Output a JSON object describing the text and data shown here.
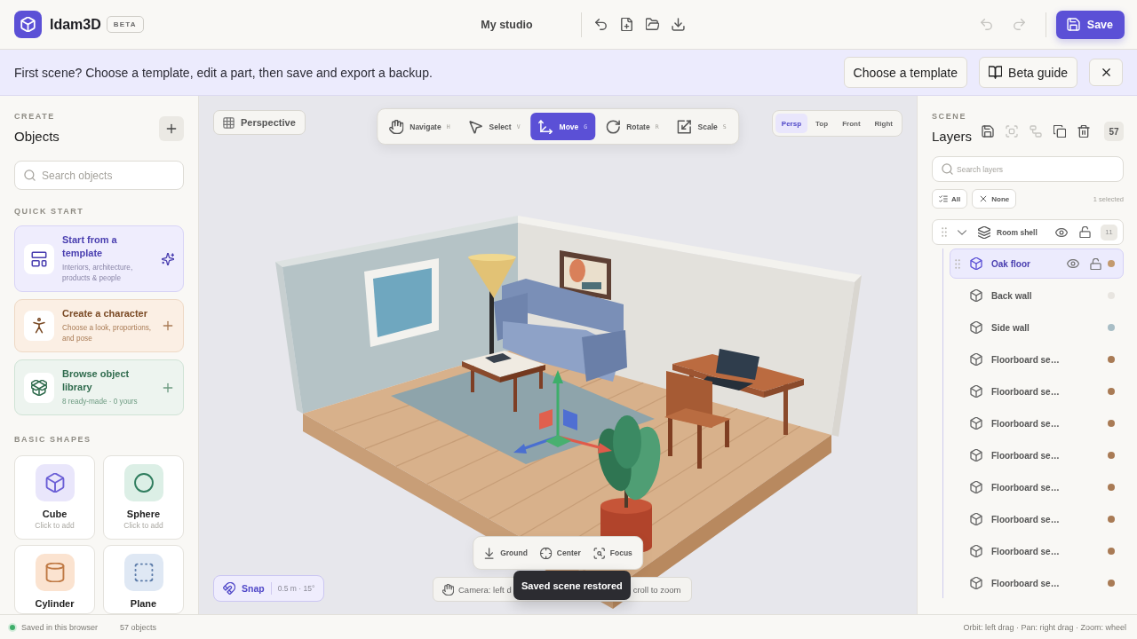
{
  "header": {
    "app_name": "Idam3D",
    "badge": "BETA",
    "project_title": "My studio",
    "history": [
      {
        "kind": "undo",
        "disabled": true
      },
      {
        "kind": "redo",
        "disabled": true
      }
    ],
    "save_label": "Save"
  },
  "banner": {
    "message": "First scene? Choose a template, edit a part, then save and export a backup.",
    "actions": [
      {
        "kind": "text",
        "label": "Choose a template"
      },
      {
        "kind": "guide",
        "label": "Beta guide"
      }
    ]
  },
  "objects_panel": {
    "eyebrow": "CREATE",
    "title": "Objects",
    "search": {
      "placeholder": "Search objects"
    },
    "quick_start_heading": "QUICK START",
    "quick_start": [
      {
        "kind": "template",
        "title": "Start from a template",
        "description": "Interiors, architecture, products & people"
      },
      {
        "kind": "character",
        "title": "Create a character",
        "description": "Choose a look, proportions, and pose"
      },
      {
        "kind": "library",
        "title": "Browse object library",
        "description": "8 ready-made · 0 yours"
      }
    ],
    "shapes_heading": "BASIC SHAPES",
    "shapes": [
      {
        "kind": "cube",
        "name": "Cube",
        "hint": "Click to add"
      },
      {
        "kind": "sphere",
        "name": "Sphere",
        "hint": "Click to add"
      },
      {
        "kind": "cylinder",
        "name": "Cylinder"
      },
      {
        "kind": "plane",
        "name": "Plane"
      }
    ]
  },
  "viewport": {
    "view_mode": "Perspective",
    "tools": [
      {
        "kind": "navigate",
        "label": "Navigate",
        "shortcut": "H",
        "selected": false
      },
      {
        "kind": "select",
        "label": "Select",
        "shortcut": "V",
        "selected": false
      },
      {
        "kind": "move",
        "label": "Move",
        "shortcut": "G",
        "selected": true
      },
      {
        "kind": "rotate",
        "label": "Rotate",
        "shortcut": "R",
        "selected": false
      },
      {
        "kind": "scale",
        "label": "Scale",
        "shortcut": "S",
        "selected": false
      }
    ],
    "views": [
      {
        "label": "Persp",
        "selected": true
      },
      {
        "label": "Top",
        "selected": false
      },
      {
        "label": "Front",
        "selected": false
      },
      {
        "label": "Right",
        "selected": false
      }
    ],
    "actions": [
      {
        "kind": "ground",
        "label": "Ground"
      },
      {
        "kind": "center",
        "label": "Center"
      },
      {
        "kind": "focus",
        "label": "Focus"
      }
    ],
    "snap": {
      "label": "Snap",
      "value": "0.5 m · 15°",
      "on": true
    },
    "camera_hint": {
      "start": "Camera: left d",
      "end": "croll to zoom"
    },
    "toast": "Saved scene restored"
  },
  "layers_panel": {
    "eyebrow": "SCENE",
    "title": "Layers",
    "toolbar": [
      {
        "kind": "save",
        "disabled": false
      },
      {
        "kind": "frame",
        "disabled": true
      },
      {
        "kind": "group",
        "disabled": true
      },
      {
        "kind": "duplicate",
        "disabled": false
      },
      {
        "kind": "delete",
        "disabled": false
      }
    ],
    "count": "57",
    "search": {
      "placeholder": "Search layers"
    },
    "filters": [
      {
        "kind": "all",
        "label": "All"
      },
      {
        "kind": "none",
        "label": "None"
      }
    ],
    "selection_summary": "1 selected",
    "layers": [
      {
        "name": "Room shell",
        "expanded": true,
        "selected": false,
        "count": "11",
        "children": [
          {
            "name": "Oak floor",
            "selected": true,
            "color": "#c39a6e"
          },
          {
            "name": "Back wall",
            "selected": false,
            "color": "#e8e5e0"
          },
          {
            "name": "Side wall",
            "selected": false,
            "color": "#a9bec6"
          },
          {
            "name": "Floorboard se…",
            "selected": false,
            "color": "#a97b55"
          },
          {
            "name": "Floorboard se…",
            "selected": false,
            "color": "#a97b55"
          },
          {
            "name": "Floorboard se…",
            "selected": false,
            "color": "#a97b55"
          },
          {
            "name": "Floorboard se…",
            "selected": false,
            "color": "#a97b55"
          },
          {
            "name": "Floorboard se…",
            "selected": false,
            "color": "#a97b55"
          },
          {
            "name": "Floorboard se…",
            "selected": false,
            "color": "#a97b55"
          },
          {
            "name": "Floorboard se…",
            "selected": false,
            "color": "#a97b55"
          },
          {
            "name": "Floorboard se…",
            "selected": false,
            "color": "#a97b55"
          }
        ]
      }
    ]
  },
  "status_bar": {
    "save_state": "Saved in this browser",
    "object_count": "57 objects",
    "hints": "Orbit: left drag · Pan: right drag · Zoom: wheel"
  }
}
